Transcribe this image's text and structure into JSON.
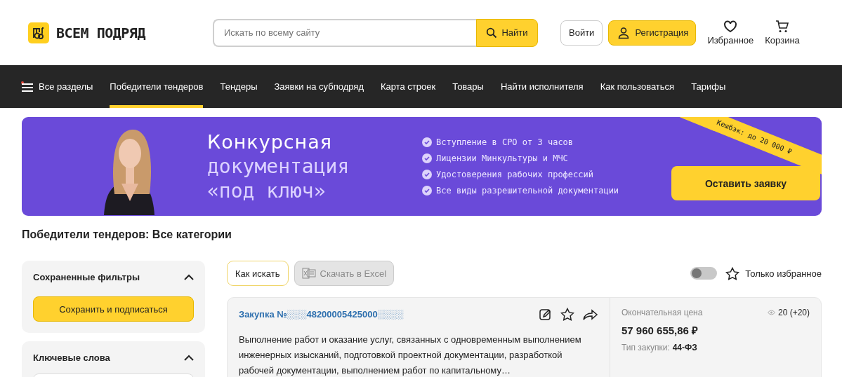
{
  "header": {
    "logo": "ВСЕМ ПОДРЯД",
    "search": {
      "placeholder": "Искать по всему сайту",
      "button": "Найти"
    },
    "login": "Войти",
    "register": "Регистрация",
    "favorites": "Избранное",
    "cart": "Корзина"
  },
  "nav": {
    "all_sections": "Все разделы",
    "items": [
      {
        "label": "Победители тендеров",
        "selected": true
      },
      {
        "label": "Тендеры",
        "selected": false
      },
      {
        "label": "Заявки на субподряд",
        "selected": false
      },
      {
        "label": "Карта строек",
        "selected": false
      },
      {
        "label": "Товары",
        "selected": false
      },
      {
        "label": "Найти исполнителя",
        "selected": false
      },
      {
        "label": "Как пользоваться",
        "selected": false
      },
      {
        "label": "Тарифы",
        "selected": false
      }
    ]
  },
  "banner": {
    "title_lines": [
      "Конкурсная",
      "документация",
      "«под ключ»"
    ],
    "benefits": [
      "Вступление в СРО от 3 часов",
      "Лицензии Минкультуры и МЧС",
      "Удостоверения рабочих профессий",
      "Все виды разрешительной документации"
    ],
    "ribbon": "Кешбэк: до 20 000 ₽",
    "button": "Оставить заявку"
  },
  "page_title": "Победители тендеров: Все категории",
  "sidebar": [
    {
      "title": "Сохраненные фильтры",
      "expanded": true,
      "button": "Сохранить и подписаться"
    },
    {
      "title": "Ключевые слова",
      "expanded": true
    }
  ],
  "toolbar": {
    "how_to": "Как искать",
    "excel": {
      "label": "Скачать в Excel",
      "disabled": true
    },
    "favorites_only": {
      "label": "Только избранное",
      "on": false
    }
  },
  "results": [
    {
      "title": "Закупка №░░░48200005425000░░░░",
      "description": "Выполнение работ и оказание услуг, связанных с одновременным выполнением инженерных изысканий, подготовкой проектной документации, разработкой рабочей документации, выполнением работ по капитальному…",
      "price_label": "Окончательная цена",
      "price": "57 960 655,86 ₽",
      "type_label": "Тип закупки:",
      "type": "44-ФЗ",
      "views": "20 (+20)"
    }
  ]
}
